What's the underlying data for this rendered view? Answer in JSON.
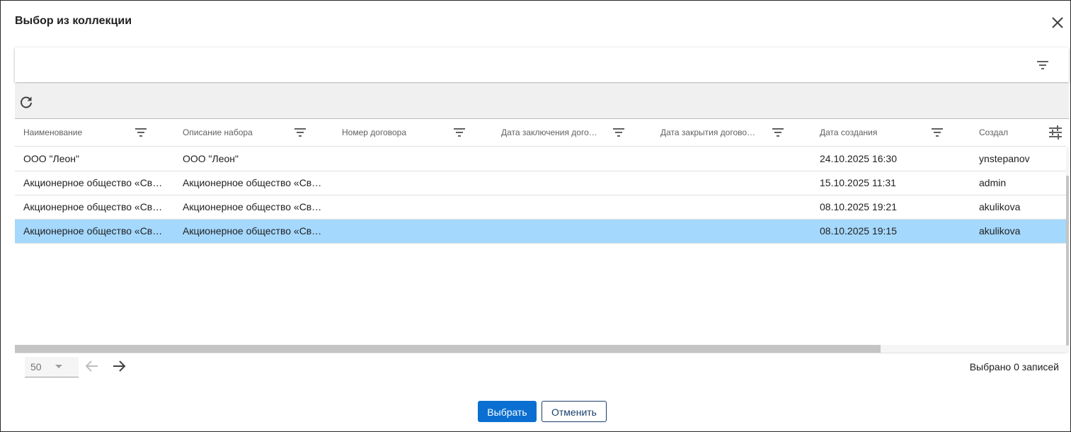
{
  "dialog": {
    "title": "Выбор из коллекции"
  },
  "icons": {
    "close": "close-icon",
    "search_filter": "filter-icon",
    "refresh": "refresh-icon",
    "column_filter": "filter-icon",
    "columns_settings": "tune-icon",
    "prev": "arrow-left-icon",
    "next": "arrow-right-icon"
  },
  "grid": {
    "columns": [
      {
        "label": "Наименование"
      },
      {
        "label": "Описание набора"
      },
      {
        "label": "Номер договора"
      },
      {
        "label": "Дата заключения дого…"
      },
      {
        "label": "Дата закрытия догово…"
      },
      {
        "label": "Дата создания"
      },
      {
        "label": "Создал"
      }
    ],
    "rows": [
      {
        "name": "ООО \"Леон\"",
        "description": "ООО \"Леон\"",
        "contract_no": "",
        "contract_date": "",
        "close_date": "",
        "created": "24.10.2025 16:30",
        "author": "ynstepanov",
        "selected": false
      },
      {
        "name": "Акционерное общество «Св…",
        "description": "Акционерное общество «Св…",
        "contract_no": "",
        "contract_date": "",
        "close_date": "",
        "created": "15.10.2025 11:31",
        "author": "admin",
        "selected": false
      },
      {
        "name": "Акционерное общество «Св…",
        "description": "Акционерное общество «Св…",
        "contract_no": "",
        "contract_date": "",
        "close_date": "",
        "created": "08.10.2025 19:21",
        "author": "akulikova",
        "selected": false
      },
      {
        "name": "Акционерное общество «Св…",
        "description": "Акционерное общество «Св…",
        "contract_no": "",
        "contract_date": "",
        "close_date": "",
        "created": "08.10.2025 19:15",
        "author": "akulikova",
        "selected": true
      }
    ]
  },
  "pager": {
    "page_size": "50",
    "selected_count_text": "Выбрано 0 записей"
  },
  "buttons": {
    "select_label": "Выбрать",
    "cancel_label": "Отменить"
  },
  "colors": {
    "primary": "#0a6fd1",
    "selected_row": "#a5d8fd",
    "toolbar_bg": "#f0f0f0"
  }
}
